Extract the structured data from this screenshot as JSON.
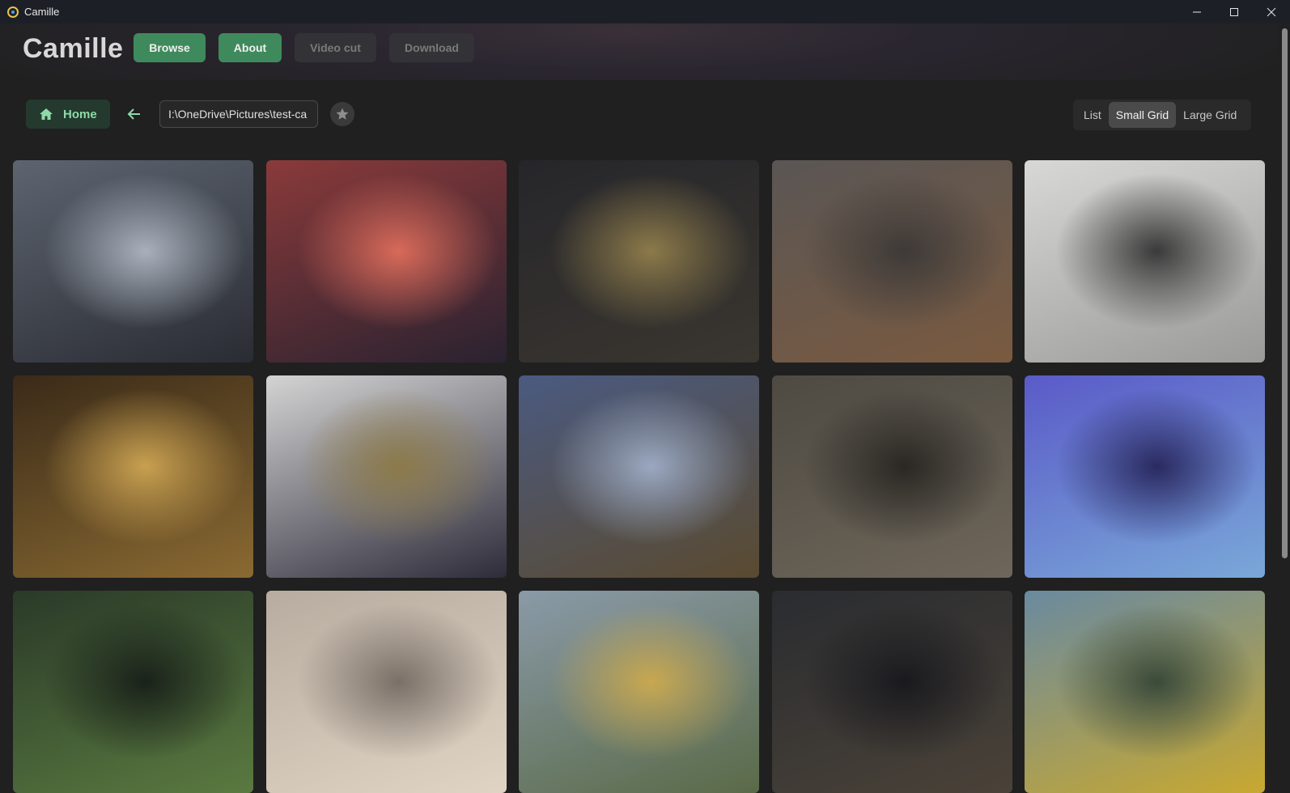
{
  "window": {
    "title": "Camille"
  },
  "app": {
    "brand": "Camille"
  },
  "nav": {
    "browse_label": "Browse",
    "about_label": "About",
    "videocut_label": "Video cut",
    "download_label": "Download"
  },
  "toolbar": {
    "home_label": "Home",
    "path_value": "I:\\OneDrive\\Pictures\\test-ca",
    "views": [
      "List",
      "Small Grid",
      "Large Grid"
    ],
    "selected_view": "Small Grid"
  },
  "colors": {
    "accent": "#3f8a5c",
    "background": "#202020",
    "home_text": "#8fd9a8"
  },
  "icons": {
    "home": "home-icon",
    "back": "arrow-left-icon",
    "favorite": "star-icon",
    "minimize": "minimize-icon",
    "maximize": "maximize-icon",
    "close": "close-icon"
  },
  "gallery": {
    "tiles": [
      {
        "palette": [
          "#5d6470",
          "#2a2c33",
          "#a8b0bb"
        ]
      },
      {
        "palette": [
          "#8a3a3a",
          "#2a2230",
          "#d86a5a"
        ]
      },
      {
        "palette": [
          "#26262a",
          "#3a3630",
          "#8c7a4a"
        ]
      },
      {
        "palette": [
          "#5a5654",
          "#7a5a40",
          "#3e3a38"
        ]
      },
      {
        "palette": [
          "#d8d8d6",
          "#9a9a98",
          "#3a3a3a"
        ]
      },
      {
        "palette": [
          "#3a2a18",
          "#8a6a32",
          "#c8a050"
        ]
      },
      {
        "palette": [
          "#d4d4d4",
          "#2e2c3a",
          "#8c7a4a"
        ]
      },
      {
        "palette": [
          "#4a5a80",
          "#5a4a30",
          "#9aa8c0"
        ]
      },
      {
        "palette": [
          "#4e4a42",
          "#6e665a",
          "#2a2824"
        ]
      },
      {
        "palette": [
          "#5a5ac8",
          "#7aa8d8",
          "#2a2a60"
        ]
      },
      {
        "palette": [
          "#2a3a28",
          "#5a7a40",
          "#1a221a"
        ]
      },
      {
        "palette": [
          "#b8aca0",
          "#e0d4c4",
          "#7a7068"
        ]
      },
      {
        "palette": [
          "#8a9aa8",
          "#5a6a48",
          "#c8a850"
        ]
      },
      {
        "palette": [
          "#2a2c30",
          "#4a4238",
          "#1a1a1e"
        ]
      },
      {
        "palette": [
          "#6a8aa0",
          "#c8a830",
          "#3a4a3a"
        ]
      }
    ]
  }
}
